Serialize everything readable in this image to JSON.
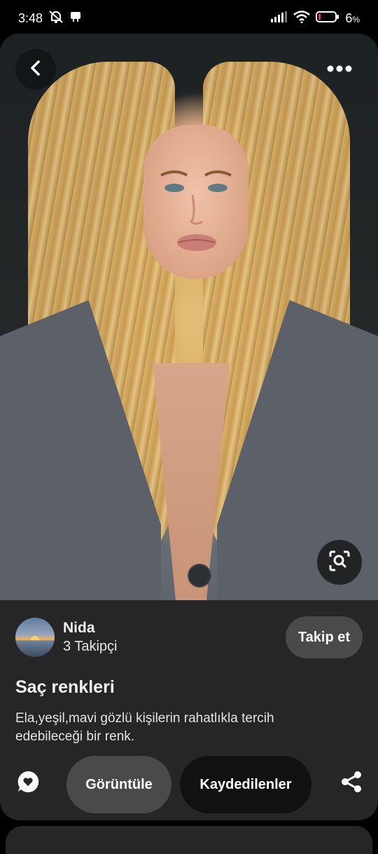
{
  "status_bar": {
    "time": "3:48",
    "battery": "6",
    "icons": [
      "do-not-disturb-icon",
      "notification-icon",
      "signal-icon",
      "wifi-icon",
      "battery-icon"
    ]
  },
  "pin": {
    "author": {
      "name": "Nida",
      "followers": "3 Takipçi",
      "follow_label": "Takip et"
    },
    "title": "Saç renkleri",
    "description": "Ela,yeşil,mavi gözlü kişilerin rahatlıkla tercih edebileceği bir renk.",
    "actions": {
      "view_label": "Görüntüle",
      "saved_label": "Kaydedilenler"
    },
    "colors": {
      "card_bg": "#262626",
      "secondary_button": "#4a4a4a",
      "primary_button": "#111111"
    }
  }
}
